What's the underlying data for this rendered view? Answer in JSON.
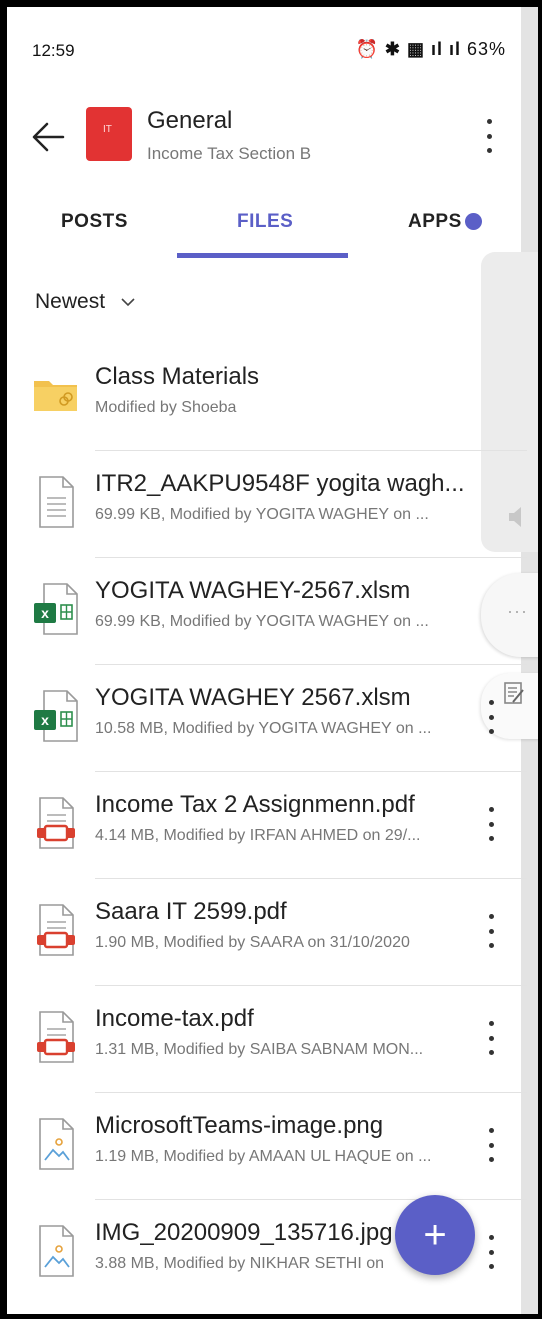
{
  "status_bar": {
    "time": "12:59",
    "indicators": "⏰ ✱ ▦ ıl  ıl",
    "battery": "63%"
  },
  "header": {
    "back_icon": "arrow-left-icon",
    "team_initials": "IT",
    "team_color": "#e23333",
    "title": "General",
    "subtitle": "Income Tax Section B"
  },
  "tabs": [
    {
      "label": "POSTS",
      "active": false
    },
    {
      "label": "FILES",
      "active": true
    },
    {
      "label": "APPS",
      "active": false,
      "badge": true
    }
  ],
  "accent_color": "#5b5fc7",
  "sort": {
    "label": "Newest"
  },
  "files": [
    {
      "type": "folder",
      "name": "Class Materials",
      "meta": "Modified by Shoeba"
    },
    {
      "type": "doc",
      "name": "ITR2_AAKPU9548F yogita wagh...",
      "meta": "69.99 KB, Modified by YOGITA WAGHEY on ..."
    },
    {
      "type": "excel",
      "name": "YOGITA WAGHEY-2567.xlsm",
      "meta": "69.99 KB, Modified by YOGITA WAGHEY on ..."
    },
    {
      "type": "excel",
      "name": "YOGITA WAGHEY 2567.xlsm",
      "meta": "10.58 MB, Modified by YOGITA WAGHEY on ..."
    },
    {
      "type": "pdf",
      "name": "Income Tax 2 Assignmenn.pdf",
      "meta": "4.14 MB, Modified by IRFAN AHMED on 29/..."
    },
    {
      "type": "pdf",
      "name": "Saara IT 2599.pdf",
      "meta": "1.90 MB, Modified by SAARA on 31/10/2020"
    },
    {
      "type": "pdf",
      "name": "Income-tax.pdf",
      "meta": "1.31 MB, Modified by SAIBA SABNAM MON..."
    },
    {
      "type": "image",
      "name": "MicrosoftTeams-image.png",
      "meta": "1.19 MB, Modified by AMAAN UL HAQUE on ..."
    },
    {
      "type": "image",
      "name": "IMG_20200909_135716.jpg",
      "meta": "3.88 MB, Modified by NIKHAR SETHI on"
    }
  ],
  "fab": {
    "label": "+"
  }
}
